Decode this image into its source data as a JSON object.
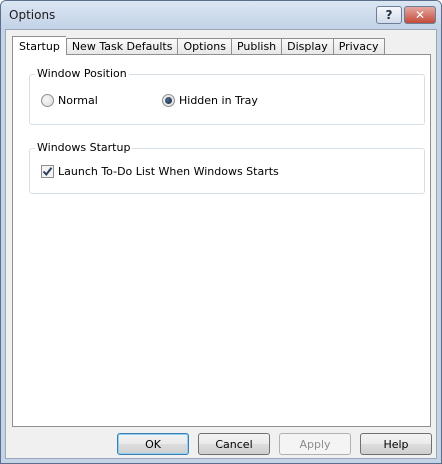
{
  "window": {
    "title": "Options",
    "help_label": "?",
    "close_label": "✕"
  },
  "tabs": [
    {
      "label": "Startup",
      "active": true
    },
    {
      "label": "New Task Defaults"
    },
    {
      "label": "Options"
    },
    {
      "label": "Publish"
    },
    {
      "label": "Display"
    },
    {
      "label": "Privacy"
    }
  ],
  "window_position": {
    "label": "Window Position",
    "normal_label": "Normal",
    "hidden_label": "Hidden in Tray",
    "selected": "hidden"
  },
  "windows_startup": {
    "label": "Windows Startup",
    "launch_label": "Launch To-Do List When Windows Starts",
    "launch_checked": true
  },
  "buttons": {
    "ok": "OK",
    "cancel": "Cancel",
    "apply": "Apply",
    "help": "Help"
  }
}
